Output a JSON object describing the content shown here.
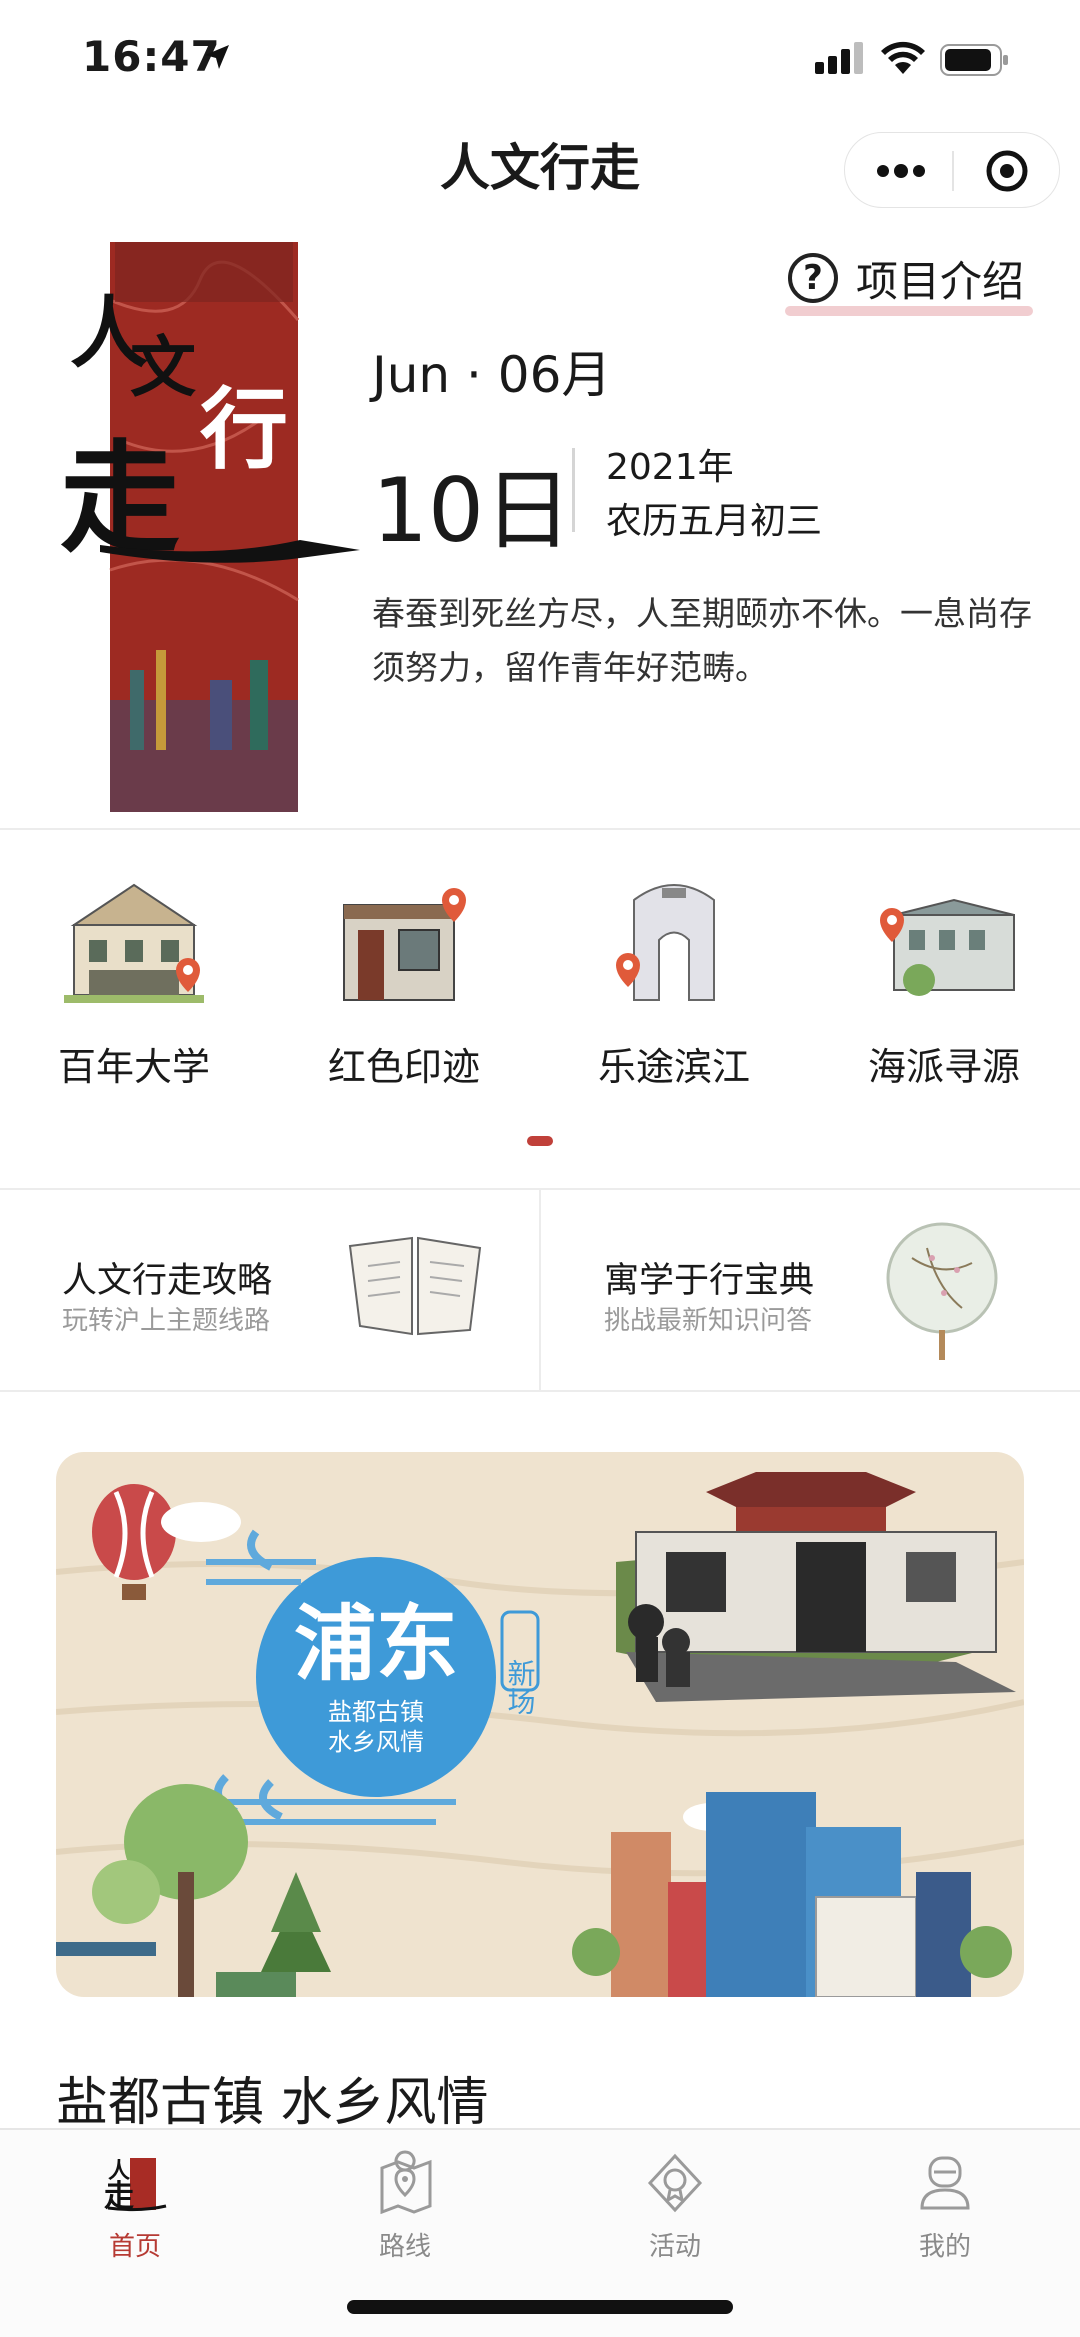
{
  "status_bar": {
    "time": "16:47"
  },
  "nav": {
    "title": "人文行走"
  },
  "header": {
    "intro_label": "项目介绍",
    "month": "Jun · 06月",
    "day": "10日",
    "year": "2021年",
    "lunar": "农历五月初三",
    "quote": "春蚕到死丝方尽，人至期颐亦不休。一息尚存须努力，留作青年好范畴。",
    "poster_text": "人文行走"
  },
  "categories": [
    {
      "label": "百年大学",
      "icon": "university-building-icon"
    },
    {
      "label": "红色印迹",
      "icon": "red-heritage-house-icon"
    },
    {
      "label": "乐途滨江",
      "icon": "riverside-gate-icon"
    },
    {
      "label": "海派寻源",
      "icon": "shanghai-style-house-icon"
    }
  ],
  "cards": [
    {
      "title": "人文行走攻略",
      "subtitle": "玩转沪上主题线路",
      "icon": "open-book-icon"
    },
    {
      "title": "寓学于行宝典",
      "subtitle": "挑战最新知识问答",
      "icon": "round-fan-icon"
    }
  ],
  "banner": {
    "circle_title": "浦东",
    "circle_sub1": "盐都古镇",
    "circle_sub2": "水乡风情",
    "tag": "新场",
    "caption": "盐都古镇 水乡风情"
  },
  "tabs": [
    {
      "label": "首页",
      "icon": "home-logo-icon",
      "active": true
    },
    {
      "label": "路线",
      "icon": "route-map-icon",
      "active": false
    },
    {
      "label": "活动",
      "icon": "activity-badge-icon",
      "active": false
    },
    {
      "label": "我的",
      "icon": "profile-icon",
      "active": false
    }
  ],
  "colors": {
    "accent": "#b63a33",
    "poster_red": "#9d2a22",
    "underline": "#f1cdd0",
    "banner_bg": "#efe3cf",
    "circle_blue": "#3e9ad8"
  }
}
